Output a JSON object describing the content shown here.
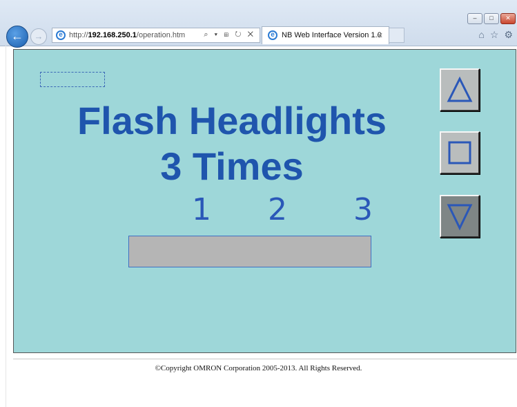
{
  "browser": {
    "address_prefix": "http://",
    "address_host": "192.168.250.1",
    "address_path": "/operation.htm",
    "address_tools": "⌕ ▾ ⊞ ↻ ✕",
    "tab_title": "NB Web Interface Version 1.0",
    "tab_close": "✕",
    "back_glyph": "←",
    "forward_glyph": "→",
    "window_controls": {
      "minimize": "–",
      "maximize": "□",
      "close": "✕"
    },
    "toolbar_icons": {
      "home": "⌂",
      "favorites": "☆",
      "settings": "⚙"
    }
  },
  "hmi": {
    "headline_line1": "Flash Headlights",
    "headline_line2": "3 Times",
    "steps": [
      "1",
      "2",
      "3"
    ],
    "progress_value": 0,
    "buttons": {
      "up": {
        "icon": "up-triangle-icon"
      },
      "stop": {
        "icon": "square-icon"
      },
      "down": {
        "icon": "down-triangle-icon"
      }
    },
    "colors": {
      "background": "#9ed7d9",
      "text": "#1f55ad",
      "progress_bar": "#b5b5b5"
    }
  },
  "footer": {
    "copyright": "©Copyright OMRON Corporation 2005-2013. All Rights Reserved."
  }
}
